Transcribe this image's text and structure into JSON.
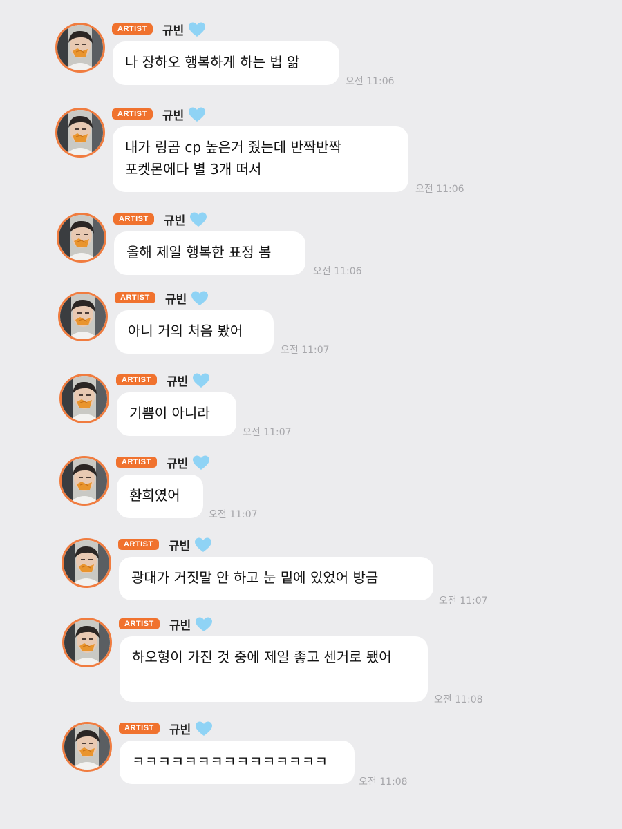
{
  "badge_label": "ARTIST",
  "sender_name": "규빈",
  "icons": {
    "heart": "light-blue-heart-icon",
    "avatar": "profile-photo"
  },
  "colors": {
    "badge": "#f0722e",
    "avatar_ring": "#f07c3f",
    "heart": "#8fd3f5",
    "background": "#ececee"
  },
  "messages": [
    {
      "text": "나 장하오 행복하게 하는 법 앎",
      "time": "오전 11:06"
    },
    {
      "text": "내가 링곰 cp 높은거 줬는데 반짝반짝 포켓몬에다 별 3개 떠서",
      "time": "오전 11:06"
    },
    {
      "text": "올해 제일 행복한 표정 봄",
      "time": "오전 11:06"
    },
    {
      "text": "아니 거의 처음 봤어",
      "time": "오전 11:07"
    },
    {
      "text": "기쁨이 아니라",
      "time": "오전 11:07"
    },
    {
      "text": "환희였어",
      "time": "오전 11:07"
    },
    {
      "text": "광대가 거짓말 안 하고 눈 밑에 있었어 방금",
      "time": "오전 11:07"
    },
    {
      "text": "하오형이 가진 것 중에 제일 좋고 센거로 됐어",
      "time": "오전 11:08"
    },
    {
      "text": "ㅋㅋㅋㅋㅋㅋㅋㅋㅋㅋㅋㅋㅋㅋㅋ",
      "time": "오전 11:08"
    }
  ]
}
